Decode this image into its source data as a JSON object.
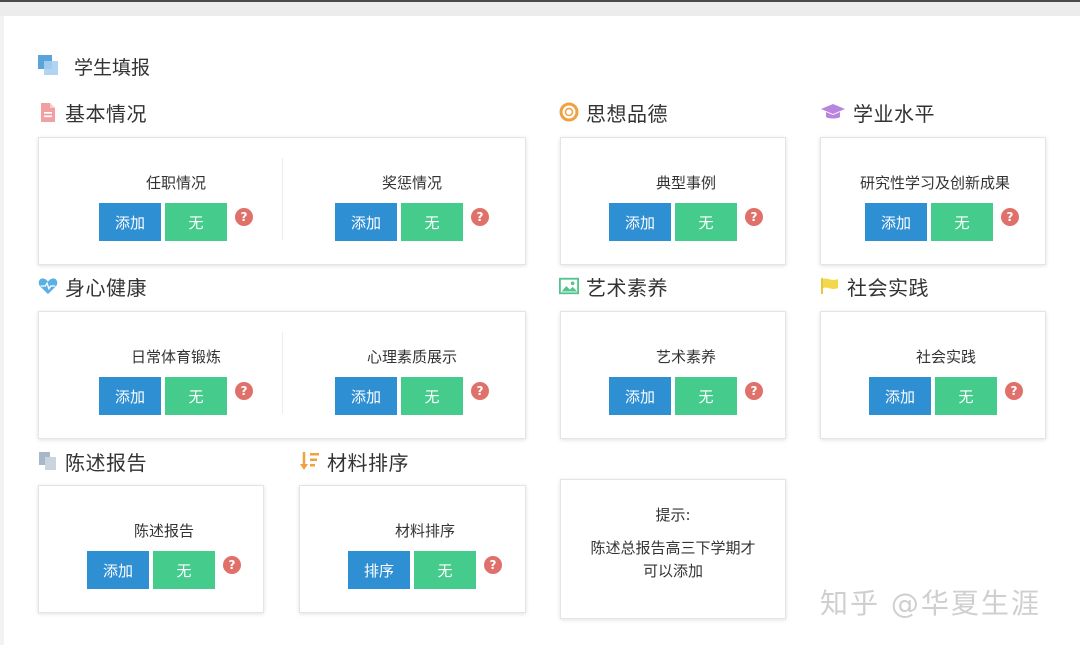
{
  "page_title": "学生填报",
  "sections": {
    "basic": {
      "title": "基本情况",
      "items": [
        {
          "label": "任职情况",
          "add": "添加",
          "none": "无",
          "help": "?"
        },
        {
          "label": "奖惩情况",
          "add": "添加",
          "none": "无",
          "help": "?"
        }
      ]
    },
    "morality": {
      "title": "思想品德",
      "items": [
        {
          "label": "典型事例",
          "add": "添加",
          "none": "无",
          "help": "?"
        }
      ]
    },
    "academic": {
      "title": "学业水平",
      "items": [
        {
          "label": "研究性学习及创新成果",
          "add": "添加",
          "none": "无",
          "help": "?"
        }
      ]
    },
    "health": {
      "title": "身心健康",
      "items": [
        {
          "label": "日常体育锻炼",
          "add": "添加",
          "none": "无",
          "help": "?"
        },
        {
          "label": "心理素质展示",
          "add": "添加",
          "none": "无",
          "help": "?"
        }
      ]
    },
    "art": {
      "title": "艺术素养",
      "items": [
        {
          "label": "艺术素养",
          "add": "添加",
          "none": "无",
          "help": "?"
        }
      ]
    },
    "social": {
      "title": "社会实践",
      "items": [
        {
          "label": "社会实践",
          "add": "添加",
          "none": "无",
          "help": "?"
        }
      ]
    },
    "report": {
      "title": "陈述报告",
      "items": [
        {
          "label": "陈述报告",
          "add": "添加",
          "none": "无",
          "help": "?"
        }
      ]
    },
    "sort": {
      "title": "材料排序",
      "items": [
        {
          "label": "材料排序",
          "add": "排序",
          "none": "无",
          "help": "?"
        }
      ]
    }
  },
  "tip": {
    "title": "提示:",
    "line1": "陈述总报告高三下学期才",
    "line2": "可以添加"
  },
  "watermark": "知乎 @华夏生涯",
  "colors": {
    "add_button": "#2f8fd3",
    "none_button": "#45cb8b",
    "help_icon": "#e0706a"
  },
  "icons": {
    "basic": "file-icon",
    "morality": "lifebuoy-icon",
    "academic": "graduation-cap-icon",
    "health": "heartbeat-icon",
    "art": "image-icon",
    "social": "flag-icon",
    "report": "copy-icon",
    "sort": "sort-icon",
    "page": "layers-icon"
  }
}
